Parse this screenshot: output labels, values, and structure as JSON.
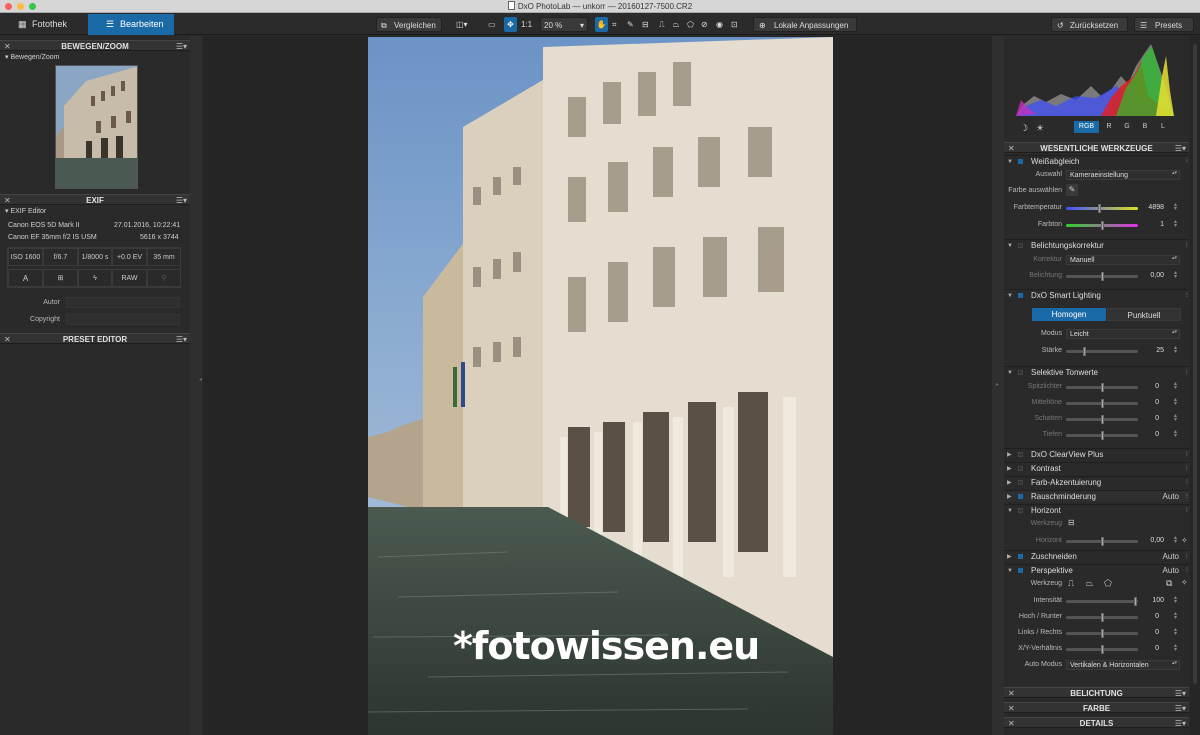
{
  "window": {
    "title": "DxO PhotoLab — unkorr — 20160127-7500.CR2"
  },
  "tabs": {
    "library": "Fotothek",
    "edit": "Bearbeiten"
  },
  "toolbar": {
    "compare": "Vergleichen",
    "zoom_1to1": "1:1",
    "zoom_level": "20 %",
    "local_adjust": "Lokale Anpassungen",
    "reset": "Zurücksetzen",
    "presets": "Presets"
  },
  "left": {
    "move_zoom": {
      "header": "BEWEGEN/ZOOM",
      "sub": "Bewegen/Zoom"
    },
    "exif": {
      "header": "EXIF",
      "sub": "EXIF Editor",
      "camera": "Canon EOS 5D Mark II",
      "datetime": "27.01.2016, 10:22:41",
      "lens": "Canon EF 35mm f/2 IS USM",
      "dims": "5616 x 3744",
      "cells": [
        "ISO 1600",
        "f/6.7",
        "1/8000 s",
        "+0.0 EV",
        "35 mm"
      ],
      "mode": "A",
      "format": "RAW",
      "author_label": "Autor",
      "copyright_label": "Copyright"
    },
    "preset_editor": {
      "header": "PRESET EDITOR"
    }
  },
  "image": {
    "watermark": "*fotowissen.eu"
  },
  "right": {
    "histogram": {
      "channels": [
        "RGB",
        "R",
        "G",
        "B",
        "L"
      ],
      "active": "RGB"
    },
    "essential": {
      "header": "WESENTLICHE WERKZEUGE"
    },
    "wb": {
      "name": "Weißabgleich",
      "select_label": "Auswahl",
      "select_value": "Kameraeinstellung",
      "pick_label": "Farbe auswählen",
      "temp_label": "Farbtemperatur",
      "temp_value": "4898",
      "tint_label": "Farbton",
      "tint_value": "1"
    },
    "exposure": {
      "name": "Belichtungskorrektur",
      "corr_label": "Korrektur",
      "corr_value": "Manuell",
      "exp_label": "Belichtung",
      "exp_value": "0,00"
    },
    "smart": {
      "name": "DxO Smart Lighting",
      "uniform": "Homogen",
      "spot": "Punktuell",
      "mode_label": "Modus",
      "mode_value": "Leicht",
      "strength_label": "Stärke",
      "strength_value": "25"
    },
    "tone": {
      "name": "Selektive Tonwerte",
      "rows": [
        {
          "label": "Spitzlichter",
          "value": "0"
        },
        {
          "label": "Mitteltöne",
          "value": "0"
        },
        {
          "label": "Schatten",
          "value": "0"
        },
        {
          "label": "Tiefen",
          "value": "0"
        }
      ]
    },
    "collapsed": [
      {
        "name": "DxO ClearView Plus",
        "auto": ""
      },
      {
        "name": "Kontrast",
        "auto": ""
      },
      {
        "name": "Farb-Akzentuierung",
        "auto": ""
      },
      {
        "name": "Rauschminderung",
        "auto": "Auto"
      }
    ],
    "horizon": {
      "name": "Horizont",
      "tool_label": "Werkzeug",
      "h_label": "Horizont",
      "h_value": "0,00"
    },
    "crop": {
      "name": "Zuschneiden",
      "auto": "Auto"
    },
    "persp": {
      "name": "Perspektive",
      "auto": "Auto",
      "tool_label": "Werkzeug",
      "rows": [
        {
          "label": "Intensität",
          "value": "100"
        },
        {
          "label": "Hoch / Runter",
          "value": "0"
        },
        {
          "label": "Links / Rechts",
          "value": "0"
        },
        {
          "label": "X/Y-Verhältnis",
          "value": "0"
        }
      ],
      "auto_mode_label": "Auto Modus",
      "auto_mode_value": "Vertikalen & Horizontalen"
    },
    "bottom": [
      "BELICHTUNG",
      "FARBE",
      "DETAILS"
    ]
  },
  "colors": {
    "accent": "#1b6aa8",
    "panel": "#2a2a2a",
    "header": "#333333"
  }
}
